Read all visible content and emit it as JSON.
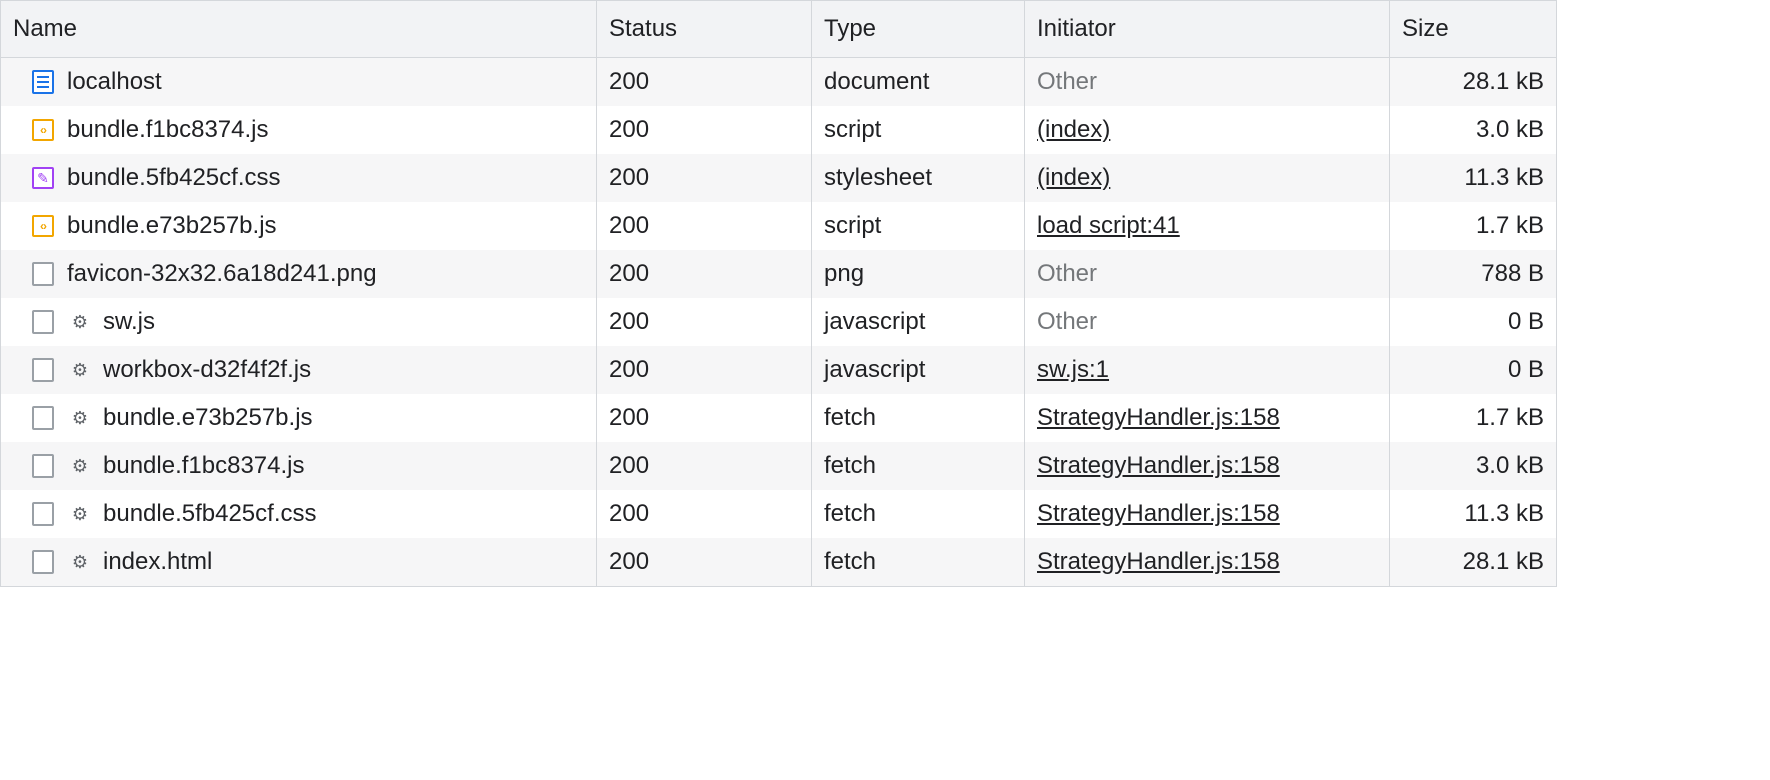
{
  "columns": {
    "name": "Name",
    "status": "Status",
    "type": "Type",
    "initiator": "Initiator",
    "size": "Size"
  },
  "rows": [
    {
      "icon": "document",
      "gear": false,
      "name": "localhost",
      "status": "200",
      "type": "document",
      "initiator": "Other",
      "initiator_link": false,
      "size": "28.1 kB"
    },
    {
      "icon": "script",
      "gear": false,
      "name": "bundle.f1bc8374.js",
      "status": "200",
      "type": "script",
      "initiator": "(index)",
      "initiator_link": true,
      "size": "3.0 kB"
    },
    {
      "icon": "stylesheet",
      "gear": false,
      "name": "bundle.5fb425cf.css",
      "status": "200",
      "type": "stylesheet",
      "initiator": "(index)",
      "initiator_link": true,
      "size": "11.3 kB"
    },
    {
      "icon": "script",
      "gear": false,
      "name": "bundle.e73b257b.js",
      "status": "200",
      "type": "script",
      "initiator": "load script:41",
      "initiator_link": true,
      "size": "1.7 kB"
    },
    {
      "icon": "other",
      "gear": false,
      "name": "favicon-32x32.6a18d241.png",
      "status": "200",
      "type": "png",
      "initiator": "Other",
      "initiator_link": false,
      "size": "788 B"
    },
    {
      "icon": "other",
      "gear": true,
      "name": "sw.js",
      "status": "200",
      "type": "javascript",
      "initiator": "Other",
      "initiator_link": false,
      "size": "0 B"
    },
    {
      "icon": "other",
      "gear": true,
      "name": "workbox-d32f4f2f.js",
      "status": "200",
      "type": "javascript",
      "initiator": "sw.js:1",
      "initiator_link": true,
      "size": "0 B"
    },
    {
      "icon": "other",
      "gear": true,
      "name": "bundle.e73b257b.js",
      "status": "200",
      "type": "fetch",
      "initiator": "StrategyHandler.js:158",
      "initiator_link": true,
      "size": "1.7 kB"
    },
    {
      "icon": "other",
      "gear": true,
      "name": "bundle.f1bc8374.js",
      "status": "200",
      "type": "fetch",
      "initiator": "StrategyHandler.js:158",
      "initiator_link": true,
      "size": "3.0 kB"
    },
    {
      "icon": "other",
      "gear": true,
      "name": "bundle.5fb425cf.css",
      "status": "200",
      "type": "fetch",
      "initiator": "StrategyHandler.js:158",
      "initiator_link": true,
      "size": "11.3 kB"
    },
    {
      "icon": "other",
      "gear": true,
      "name": "index.html",
      "status": "200",
      "type": "fetch",
      "initiator": "StrategyHandler.js:158",
      "initiator_link": true,
      "size": "28.1 kB"
    }
  ]
}
